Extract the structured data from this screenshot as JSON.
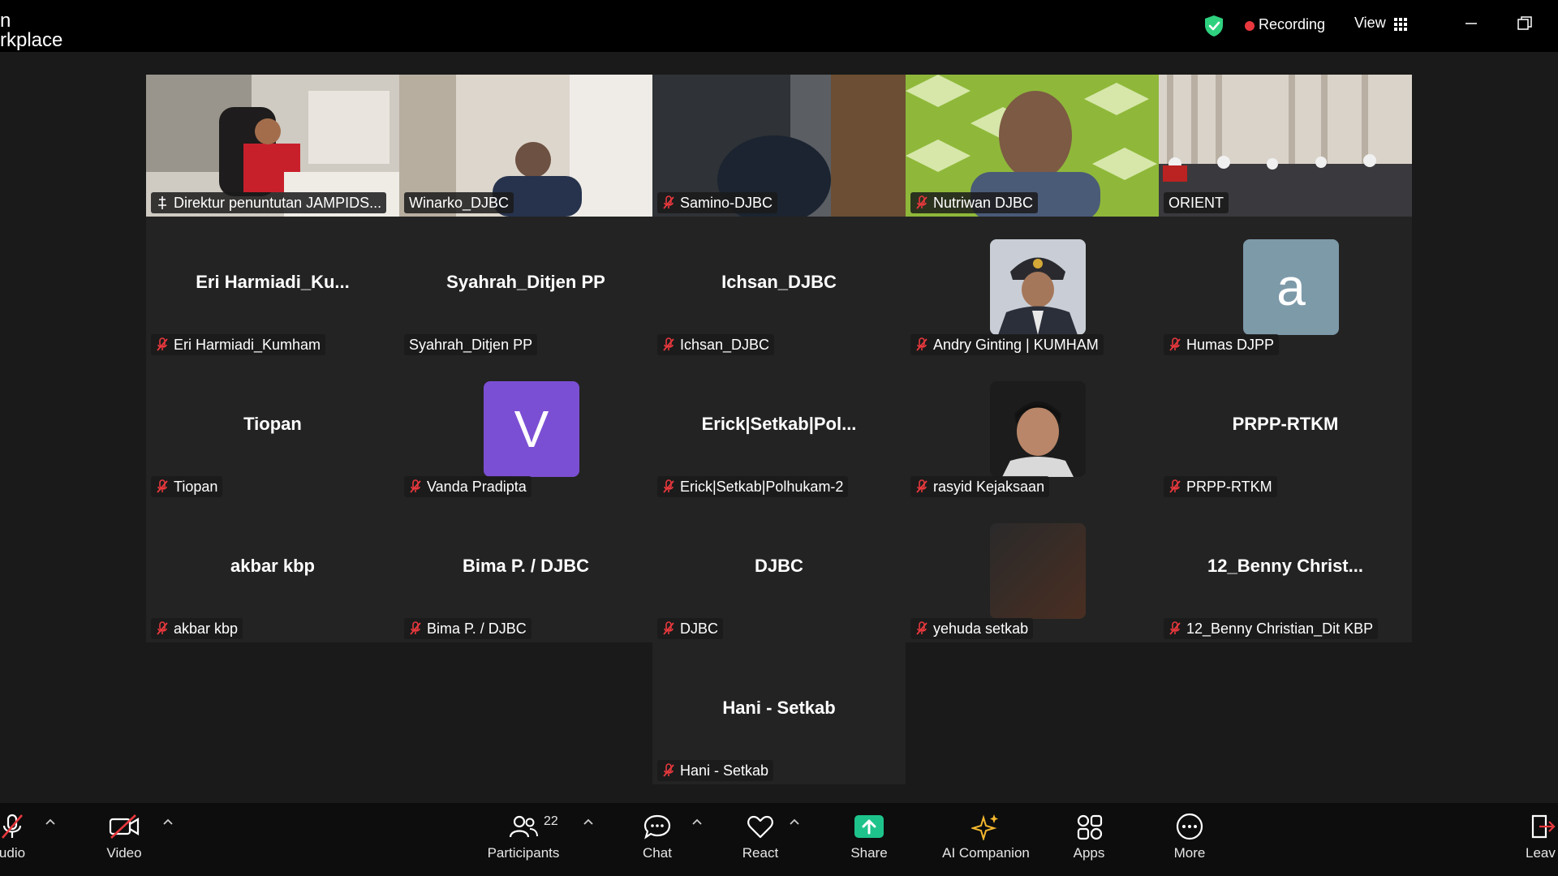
{
  "window": {
    "app_title": "n\nrkplace",
    "recording_label": "Recording",
    "view_label": "View"
  },
  "colors": {
    "active_speaker": "#2fd17f",
    "muted": "#e8383d",
    "share_green": "#1ec38b",
    "avatar_purple": "#7b4fd4",
    "avatar_slate": "#7d9aa9"
  },
  "video_tiles": [
    {
      "label": "Direktur penuntutan JAMPIDS..."
    },
    {
      "label": "Winarko_DJBC"
    },
    {
      "label": "Samino-DJBC"
    },
    {
      "label": "Nutriwan DJBC"
    },
    {
      "label": "ORIENT"
    }
  ],
  "tiles": [
    {
      "name": "Eri  Harmiadi_Ku...",
      "label": "Eri Harmiadi_Kumham"
    },
    {
      "name": "Syahrah_Ditjen PP",
      "label": "Syahrah_Ditjen PP"
    },
    {
      "name": "Ichsan_DJBC",
      "label": "Ichsan_DJBC"
    },
    {
      "name": "",
      "label": "Andry Ginting | KUMHAM"
    },
    {
      "name": "",
      "label": "Humas DJPP",
      "avatar_letter": "a"
    },
    {
      "name": "Tiopan",
      "label": "Tiopan"
    },
    {
      "name": "",
      "label": "Vanda Pradipta",
      "avatar_letter": "V"
    },
    {
      "name": "Erick|Setkab|Pol...",
      "label": "Erick|Setkab|Polhukam-2"
    },
    {
      "name": "",
      "label": "rasyid Kejaksaan"
    },
    {
      "name": "PRPP-RTKM",
      "label": "PRPP-RTKM"
    },
    {
      "name": "akbar kbp",
      "label": "akbar kbp"
    },
    {
      "name": "Bima P. / DJBC",
      "label": "Bima P. / DJBC"
    },
    {
      "name": "DJBC",
      "label": "DJBC"
    },
    {
      "name": "",
      "label": "yehuda setkab"
    },
    {
      "name": "12_Benny  Christ...",
      "label": "12_Benny Christian_Dit KBP"
    },
    {
      "name": "Hani - Setkab",
      "label": "Hani - Setkab"
    }
  ],
  "toolbar": {
    "audio": "udio",
    "video": "Video",
    "participants": "Participants",
    "participant_count": "22",
    "chat": "Chat",
    "react": "React",
    "share": "Share",
    "ai_companion": "AI Companion",
    "apps": "Apps",
    "more": "More",
    "leave": "Leav"
  }
}
